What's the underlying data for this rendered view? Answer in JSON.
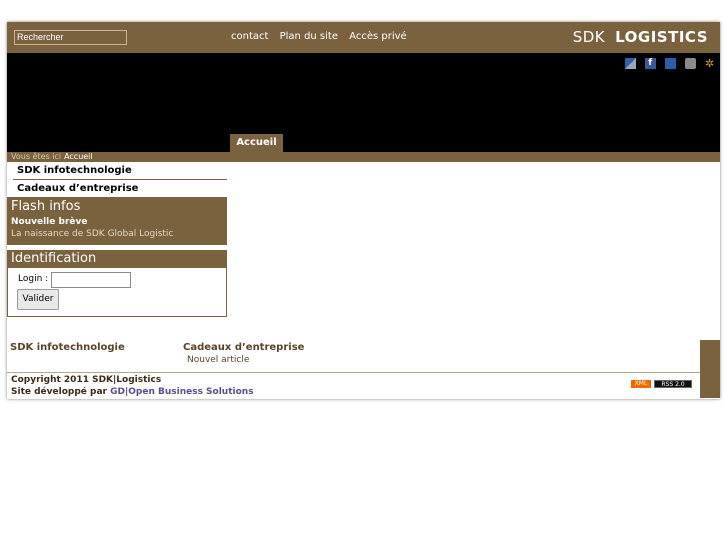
{
  "search": {
    "placeholder": "Rechercher"
  },
  "top_links": [
    "contact",
    "Plan du site",
    "Accès privé"
  ],
  "brand": {
    "part1": "SDK",
    "part2": "LOGISTICS"
  },
  "social_icons": [
    "myspace-icon",
    "facebook-icon",
    "delicious-icon",
    "digg-icon",
    "star-icon"
  ],
  "nav": {
    "tab": "Accueil"
  },
  "breadcrumb": {
    "label": "Vous êtes ici",
    "current": "Accueil"
  },
  "menu": [
    "SDK infotechnologie",
    "Cadeaux d’entreprise"
  ],
  "flash": {
    "title": "Flash infos",
    "subtitle": "Nouvelle brève",
    "text": "La naissance de SDK Global Logistic"
  },
  "identification": {
    "title": "Identification",
    "login_label": "Login :",
    "submit": "Valider"
  },
  "footer": {
    "col1": "SDK infotechnologie",
    "col2": "Cadeaux d’entreprise",
    "col2_sub": "Nouvel article",
    "copyright": "Copyright 2011 SDK|Logistics",
    "dev_prefix": "Site développé par ",
    "dev_link": "GD|Open Business Solutions",
    "badge_xml": "XML",
    "badge_rss": "RSS 2.0"
  }
}
